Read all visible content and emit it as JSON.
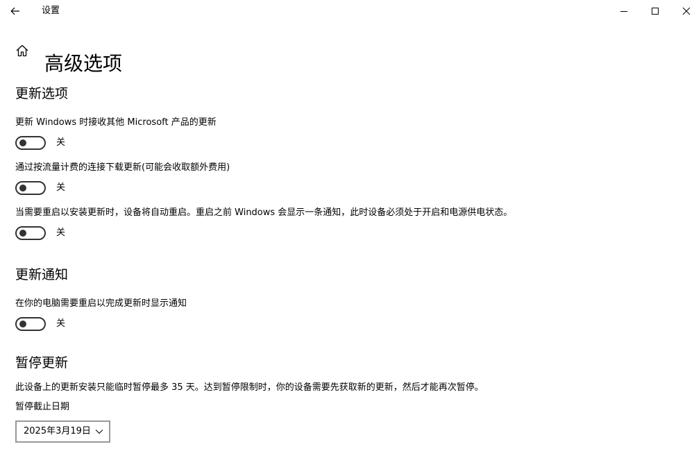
{
  "window": {
    "app_title": "设置",
    "back_icon": "back-arrow-icon",
    "minimize_icon": "minimize-icon",
    "maximize_icon": "maximize-icon",
    "close_icon": "close-icon"
  },
  "page": {
    "home_icon": "home-icon",
    "title": "高级选项"
  },
  "update_options": {
    "title": "更新选项",
    "settings": [
      {
        "label": "更新 Windows 时接收其他 Microsoft 产品的更新",
        "state": "关",
        "on": false
      },
      {
        "label": "通过按流量计费的连接下载更新(可能会收取额外费用)",
        "state": "关",
        "on": false
      },
      {
        "label": "当需要重启以安装更新时，设备将自动重启。重启之前 Windows 会显示一条通知，此时设备必须处于开启和电源供电状态。",
        "state": "关",
        "on": false
      }
    ]
  },
  "update_notifications": {
    "title": "更新通知",
    "settings": [
      {
        "label": "在你的电脑需要重启以完成更新时显示通知",
        "state": "关",
        "on": false
      }
    ]
  },
  "pause_updates": {
    "title": "暂停更新",
    "description": "此设备上的更新安装只能临时暂停最多 35 天。达到暂停限制时，你的设备需要先获取新的更新，然后才能再次暂停。",
    "date_label": "暂停截止日期",
    "date_value": "2025年3月19日",
    "dropdown_icon": "chevron-down-icon"
  },
  "colors": {
    "background": "#ffffff",
    "text": "#000000",
    "toggle_off": "#333333",
    "select_border": "#999999"
  }
}
